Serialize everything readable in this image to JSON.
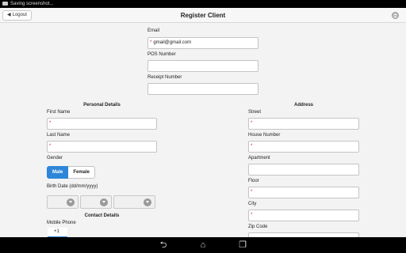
{
  "statusbar": {
    "text": "Saving screenshot..."
  },
  "header": {
    "logout_label": "Logout",
    "title": "Register Client"
  },
  "account": {
    "email_label": "Email",
    "email_value": "gmail@gmail.com",
    "pos_label": "POS Number",
    "receipt_label": "Receipt Number"
  },
  "personal": {
    "heading": "Personal Details",
    "first_name_label": "First Name",
    "last_name_label": "Last Name",
    "gender_label": "Gender",
    "gender_male": "Male",
    "gender_female": "Female",
    "birth_label": "Birth Date (dd/mm/yyyy)"
  },
  "contact": {
    "heading": "Contact Details",
    "mobile_label": "Mobile Phone",
    "country_code": "+1"
  },
  "address": {
    "heading": "Address",
    "street_label": "Street",
    "house_label": "House Number",
    "apartment_label": "Apartment",
    "floor_label": "Floor",
    "city_label": "City",
    "zip_label": "Zip Code"
  },
  "required_mark": "*",
  "colors": {
    "accent": "#2d86d9",
    "required": "#d32020"
  }
}
